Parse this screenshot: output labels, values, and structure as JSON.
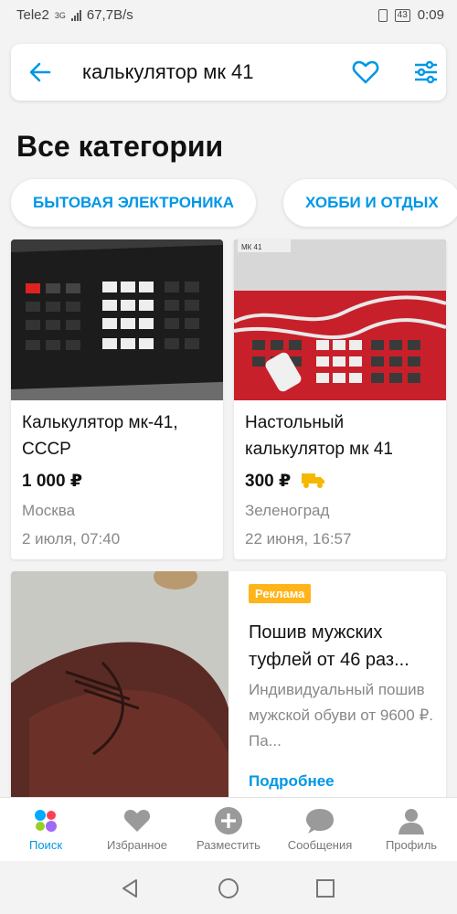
{
  "status": {
    "carrier": "Tele2",
    "net": "3G",
    "speed": "67,7B/s",
    "battery": "43",
    "time": "0:09"
  },
  "search": {
    "query": "калькулятор мк 41"
  },
  "page_title": "Все категории",
  "chips": [
    "БЫТОВАЯ ЭЛЕКТРОНИКА",
    "ХОББИ И ОТДЫХ"
  ],
  "listings": [
    {
      "title_line1": "Калькулятор мк-41,",
      "title_line2": "СССР",
      "price": "1 000 ₽",
      "city": "Москва",
      "date": "2 июля, 07:40",
      "delivery": false
    },
    {
      "title_line1": "Настольный",
      "title_line2": "калькулятор мк 41",
      "price": "300 ₽",
      "city": "Зеленоград",
      "date": "22 июня, 16:57",
      "delivery": true
    }
  ],
  "ad": {
    "badge": "Реклама",
    "title": "Пошив мужских туфлей от 46 раз...",
    "description": "Индивидуальный пошив мужской обуви от 9600 ₽. Па...",
    "more": "Подробнее"
  },
  "nav": [
    {
      "label": "Поиск",
      "icon": "search-dots-icon",
      "active": true
    },
    {
      "label": "Избранное",
      "icon": "heart-icon",
      "active": false
    },
    {
      "label": "Разместить",
      "icon": "plus-circle-icon",
      "active": false
    },
    {
      "label": "Сообщения",
      "icon": "chat-icon",
      "active": false
    },
    {
      "label": "Профиль",
      "icon": "person-icon",
      "active": false
    }
  ],
  "colors": {
    "accent": "#0097e6",
    "badge": "#ffb41a",
    "delivery": "#f5b800"
  }
}
